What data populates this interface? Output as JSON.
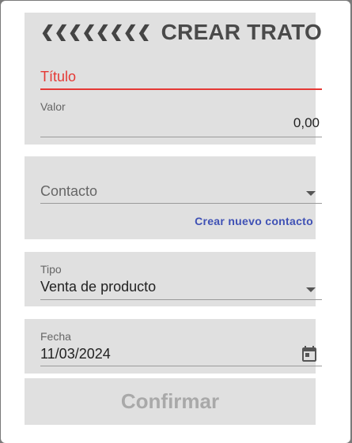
{
  "header": {
    "title": "CREAR TRATO",
    "back_icon": "chevron-left-icon"
  },
  "form": {
    "titulo": {
      "placeholder": "Título"
    },
    "valor": {
      "label": "Valor",
      "value": "0,00"
    },
    "contacto": {
      "placeholder": "Contacto",
      "create_link": "Crear nuevo contacto"
    },
    "tipo": {
      "label": "Tipo",
      "value": "Venta de producto"
    },
    "fecha": {
      "label": "Fecha",
      "value": "11/03/2024",
      "icon": "calendar-icon"
    }
  },
  "actions": {
    "confirm_label": "Confirmar"
  },
  "colors": {
    "error": "#e53935",
    "link": "#3f51b5",
    "card_bg": "#e0e0e0",
    "disabled_text": "#a9a9a9"
  }
}
